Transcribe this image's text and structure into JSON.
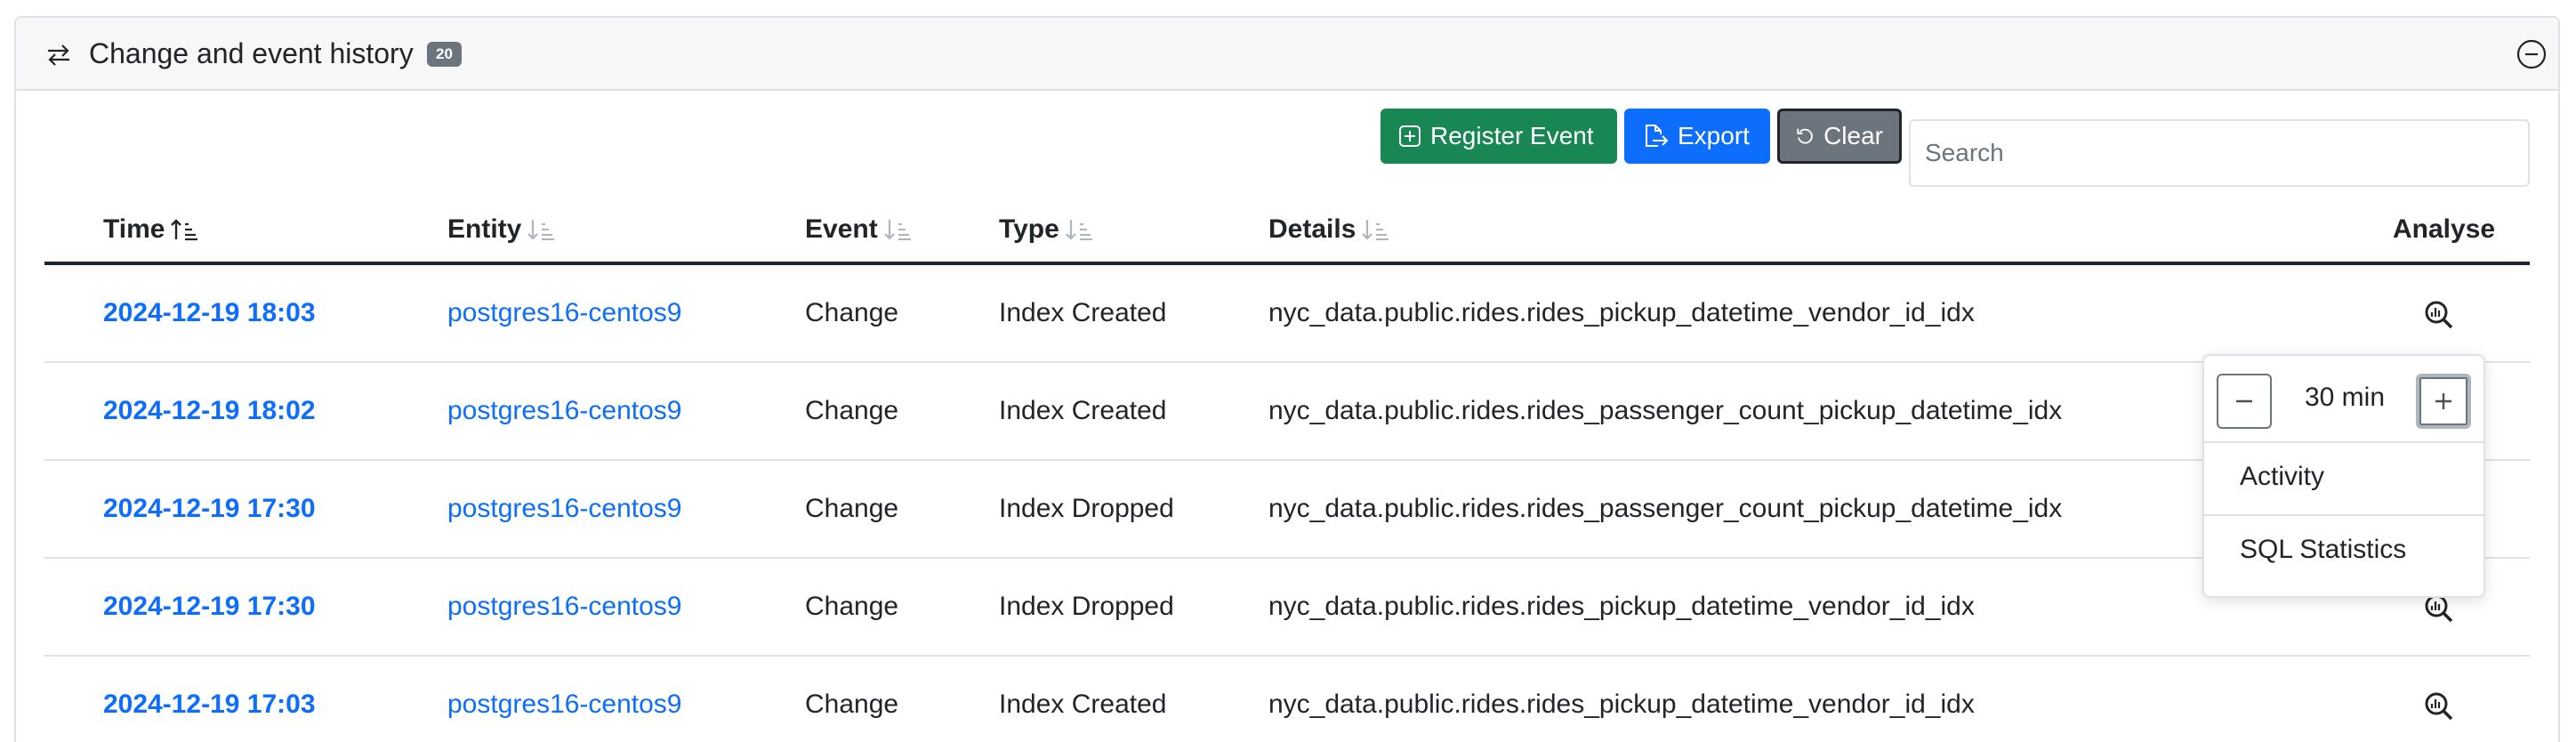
{
  "panel": {
    "title": "Change and event history",
    "badge": "20",
    "icon": "arrows-exchange-icon",
    "collapse_icon": "circle-minus-icon"
  },
  "toolbar": {
    "register_label": "Register Event",
    "export_label": "Export",
    "clear_label": "Clear",
    "search_placeholder": "Search",
    "colors": {
      "register": "#198754",
      "export": "#0d6efd",
      "clear": "#6c757d"
    }
  },
  "table": {
    "columns": {
      "time": "Time",
      "entity": "Entity",
      "event": "Event",
      "type": "Type",
      "details": "Details",
      "analyse": "Analyse"
    },
    "sort": {
      "time": "ascending",
      "entity": "none",
      "event": "none",
      "type": "none",
      "details": "none"
    },
    "rows": [
      {
        "time": "2024-12-19 18:03",
        "entity": "postgres16-centos9",
        "event": "Change",
        "type": "Index Created",
        "details": "nyc_data.public.rides.rides_pickup_datetime_vendor_id_idx"
      },
      {
        "time": "2024-12-19 18:02",
        "entity": "postgres16-centos9",
        "event": "Change",
        "type": "Index Created",
        "details": "nyc_data.public.rides.rides_passenger_count_pickup_datetime_idx"
      },
      {
        "time": "2024-12-19 17:30",
        "entity": "postgres16-centos9",
        "event": "Change",
        "type": "Index Dropped",
        "details": "nyc_data.public.rides.rides_passenger_count_pickup_datetime_idx"
      },
      {
        "time": "2024-12-19 17:30",
        "entity": "postgres16-centos9",
        "event": "Change",
        "type": "Index Dropped",
        "details": "nyc_data.public.rides.rides_pickup_datetime_vendor_id_idx"
      },
      {
        "time": "2024-12-19 17:03",
        "entity": "postgres16-centos9",
        "event": "Change",
        "type": "Index Created",
        "details": "nyc_data.public.rides.rides_pickup_datetime_vendor_id_idx"
      }
    ]
  },
  "popover": {
    "value": "30 min",
    "items": [
      "Activity",
      "SQL Statistics"
    ]
  }
}
